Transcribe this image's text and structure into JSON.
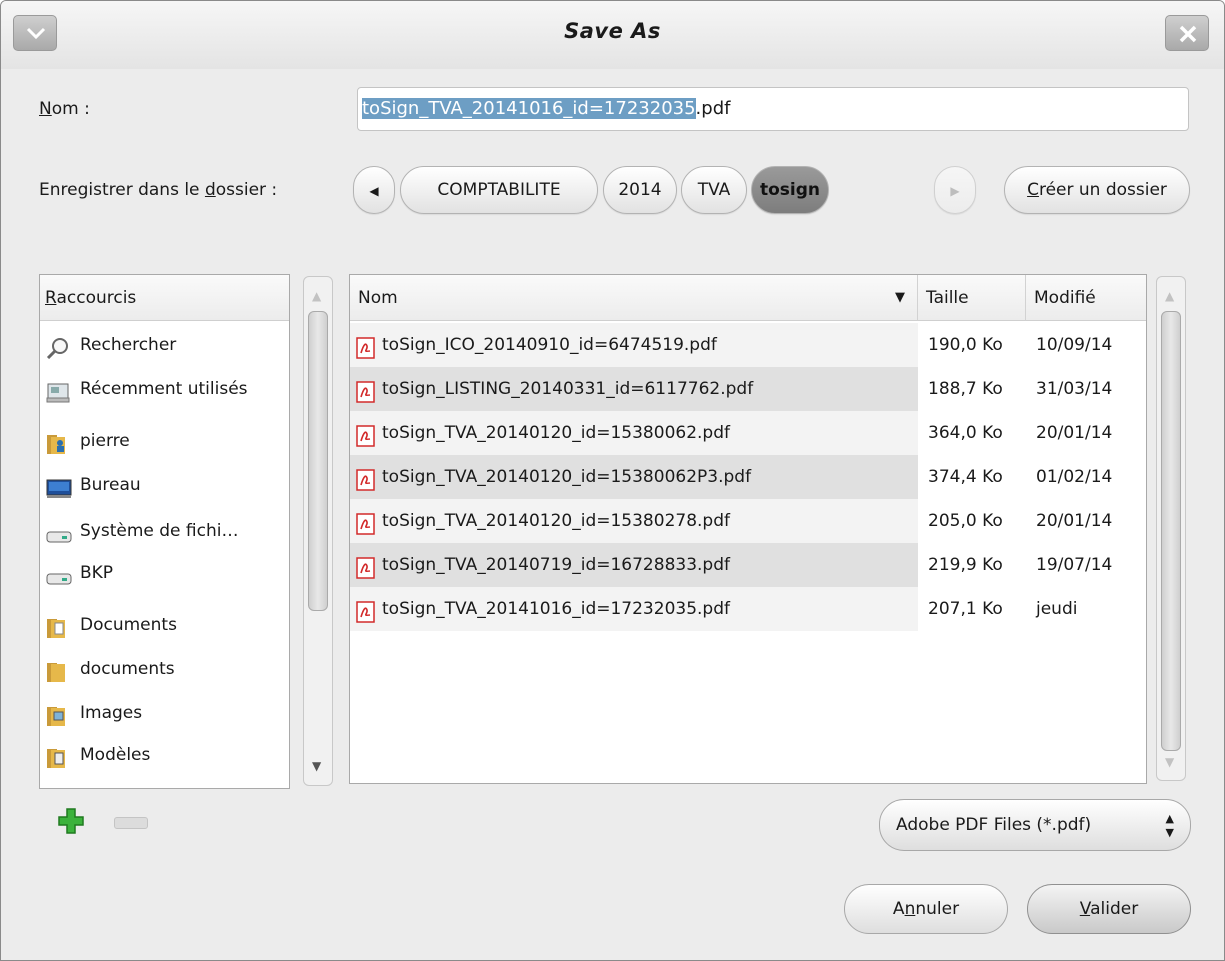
{
  "window": {
    "title": "Save As"
  },
  "name_field": {
    "label_first": "N",
    "label_rest": "om :",
    "value_selected": "toSign_TVA_20141016_id=17232035",
    "value_rest": ".pdf"
  },
  "folder": {
    "label_pre": "Enregistrer dans le ",
    "label_ul": "d",
    "label_post": "ossier :",
    "path": [
      "COMPTABILITE",
      "2014",
      "TVA",
      "tosign"
    ],
    "create_first": "C",
    "create_rest": "réer un dossier"
  },
  "sidebar": {
    "header_first": "R",
    "header_rest": "accourcis",
    "items": [
      {
        "label": "Rechercher",
        "icon": "search-icon"
      },
      {
        "label": "Récemment utilisés",
        "icon": "recent-icon"
      },
      {
        "label": "pierre",
        "icon": "home-folder-icon"
      },
      {
        "label": "Bureau",
        "icon": "desktop-icon"
      },
      {
        "label": "Système de fichi…",
        "icon": "drive-icon"
      },
      {
        "label": "BKP",
        "icon": "drive-icon"
      },
      {
        "label": "Documents",
        "icon": "documents-folder-icon"
      },
      {
        "label": "documents",
        "icon": "folder-icon"
      },
      {
        "label": "Images",
        "icon": "pictures-folder-icon"
      },
      {
        "label": "Modèles",
        "icon": "templates-folder-icon"
      }
    ]
  },
  "files": {
    "columns": [
      "Nom",
      "Taille",
      "Modifié"
    ],
    "rows": [
      {
        "name": "toSign_ICO_20140910_id=6474519.pdf",
        "size": "190,0 Ko",
        "date": "10/09/14"
      },
      {
        "name": "toSign_LISTING_20140331_id=6117762.pdf",
        "size": "188,7 Ko",
        "date": "31/03/14"
      },
      {
        "name": "toSign_TVA_20140120_id=15380062.pdf",
        "size": "364,0 Ko",
        "date": "20/01/14"
      },
      {
        "name": "toSign_TVA_20140120_id=15380062P3.pdf",
        "size": "374,4 Ko",
        "date": "01/02/14"
      },
      {
        "name": "toSign_TVA_20140120_id=15380278.pdf",
        "size": "205,0 Ko",
        "date": "20/01/14"
      },
      {
        "name": "toSign_TVA_20140719_id=16728833.pdf",
        "size": "219,9 Ko",
        "date": "19/07/14"
      },
      {
        "name": "toSign_TVA_20141016_id=17232035.pdf",
        "size": "207,1 Ko",
        "date": "jeudi"
      }
    ]
  },
  "filter": {
    "label": "Adobe PDF Files (*.pdf)"
  },
  "actions": {
    "cancel_pre": "A",
    "cancel_ul": "n",
    "cancel_post": "nuler",
    "ok_ul": "V",
    "ok_rest": "alider"
  },
  "colors": {
    "selection": "#6d9ec4",
    "pdf_red": "#d22a2a",
    "add_green": "#3cb23c"
  }
}
